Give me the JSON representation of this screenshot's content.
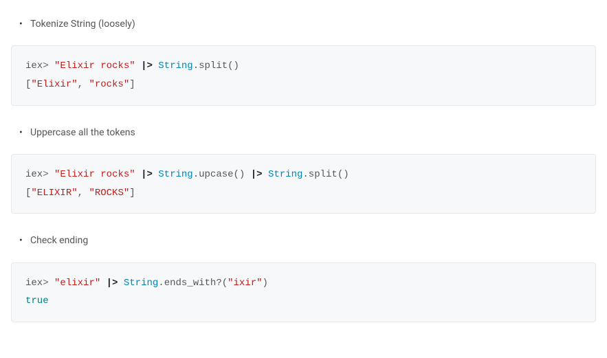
{
  "sections": [
    {
      "bullet": "Tokenize String (loosely)",
      "code": {
        "line1": {
          "prompt": "iex",
          "gt": "> ",
          "str1": "\"Elixir rocks\"",
          "sp1": " ",
          "pipe1": "|>",
          "sp2": " ",
          "mod1": "String",
          "dot1": ".",
          "meth1": "split",
          "paren1": "()"
        },
        "line2": {
          "lb": "[",
          "s1": "\"Elixir\"",
          "c1": ", ",
          "s2": "\"rocks\"",
          "rb": "]"
        }
      }
    },
    {
      "bullet": "Uppercase all the tokens",
      "code": {
        "line1": {
          "prompt": "iex",
          "gt": "> ",
          "str1": "\"Elixir rocks\"",
          "sp1": " ",
          "pipe1": "|>",
          "sp2": " ",
          "mod1": "String",
          "dot1": ".",
          "meth1": "upcase",
          "paren1": "()",
          "sp3": " ",
          "pipe2": "|>",
          "sp4": " ",
          "mod2": "String",
          "dot2": ".",
          "meth2": "split",
          "paren2": "()"
        },
        "line2": {
          "lb": "[",
          "s1": "\"ELIXIR\"",
          "c1": ", ",
          "s2": "\"ROCKS\"",
          "rb": "]"
        }
      }
    },
    {
      "bullet": "Check ending",
      "code": {
        "line1": {
          "prompt": "iex",
          "gt": "> ",
          "str1": "\"elixir\"",
          "sp1": " ",
          "pipe1": "|>",
          "sp2": " ",
          "mod1": "String",
          "dot1": ".",
          "meth1": "ends_with?",
          "lp": "(",
          "arg": "\"ixir\"",
          "rp": ")"
        },
        "line2": {
          "bool": "true"
        }
      }
    }
  ]
}
